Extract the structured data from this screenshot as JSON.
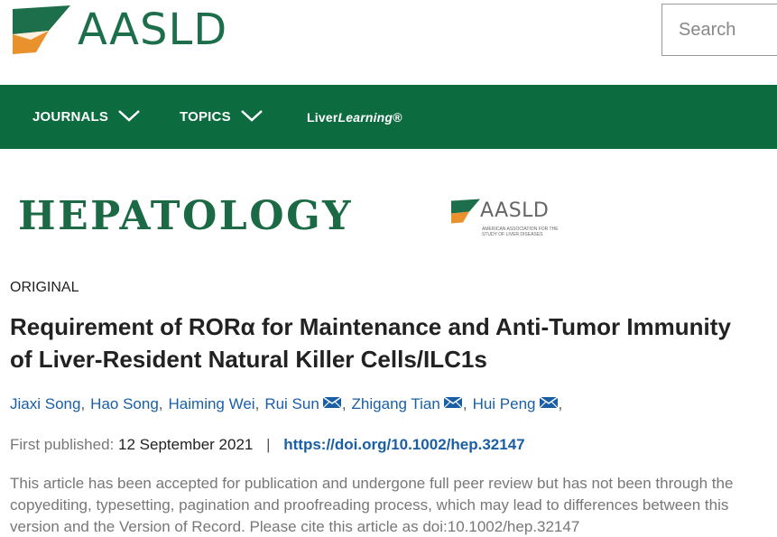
{
  "header": {
    "logo_text": "AASLD",
    "search_placeholder": "Search"
  },
  "nav": {
    "journals": "JOURNALS",
    "topics": "TOPICS",
    "liver_prefix": "Liver",
    "liver_italic": "Learning",
    "liver_suffix": "®"
  },
  "journal": {
    "name": "HEPATOLOGY",
    "logo_text": "AASLD",
    "logo_subtext": "American Association for the Study of Liver Diseases"
  },
  "article": {
    "type": "ORIGINAL",
    "title": "Requirement of RORα for Maintenance and Anti-Tumor Immunity of Liver-Resident Natural Killer Cells/ILC1s",
    "authors": [
      {
        "name": "Jiaxi Song",
        "mail": false
      },
      {
        "name": "Hao Song",
        "mail": false
      },
      {
        "name": "Haiming Wei",
        "mail": false
      },
      {
        "name": "Rui Sun",
        "mail": true
      },
      {
        "name": "Zhigang Tian",
        "mail": true
      },
      {
        "name": "Hui Peng",
        "mail": true
      }
    ],
    "first_published_label": "First published:",
    "first_published_date": "12 September 2021",
    "separator": "|",
    "doi_url": "https://doi.org/10.1002/hep.32147",
    "notice": "This article has been accepted for publication and undergone full peer review but has not been through the copyediting, typesetting, pagination and proofreading process, which may lead to differences between this version and the Version of Record. Please cite this article as doi:10.1002/hep.32147"
  },
  "colors": {
    "brand_green": "#0c6b3f",
    "logo_orange": "#e8912d",
    "link_blue": "#1a5fa6"
  }
}
